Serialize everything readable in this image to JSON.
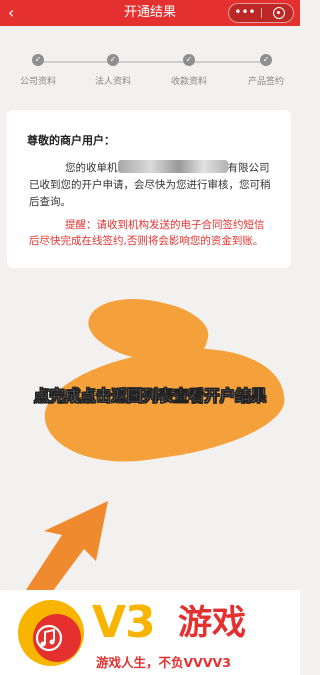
{
  "header": {
    "title": "开通结果",
    "back_icon": "chevron-left-icon",
    "more_label": "•••",
    "bar_color": "#e4312f"
  },
  "steps": [
    {
      "label": "公司资料",
      "state": "done"
    },
    {
      "label": "法人资料",
      "state": "done"
    },
    {
      "label": "收款资料",
      "state": "done"
    },
    {
      "label": "产品签约",
      "state": "done"
    }
  ],
  "card": {
    "greeting": "尊敬的商户用户：",
    "message_prefix": "您的收单机",
    "message_suffix": "有限公司已收到您的开户申请，会尽快为您进行审核，您可稍后查询。",
    "warning": "提醒：请收到机构发送的电子合同签约短信后尽快完成在线签约,否则将会影响您的资金到账。",
    "warning_color": "#e4312f"
  },
  "annotation": {
    "instruction": "点完成点击返回列表查看开户结果",
    "highlight_color": "#f5a13b"
  },
  "watermark": {
    "brand_v3": "V3",
    "brand_game": "游戏",
    "slogan": "游戏人生，不负VVVV3",
    "logo_icon": "music-note-logo-icon"
  }
}
